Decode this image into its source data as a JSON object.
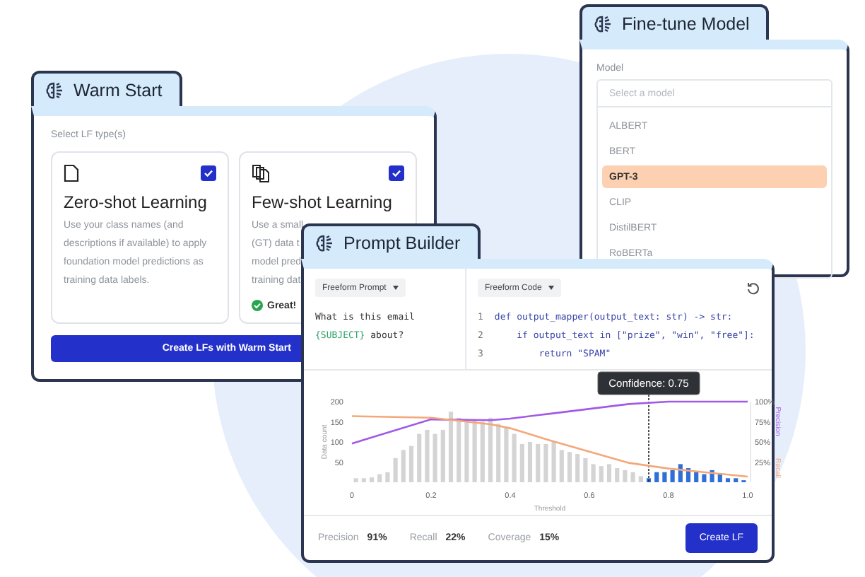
{
  "warm_start": {
    "title": "Warm Start",
    "label": "Select LF type(s)",
    "cards": [
      {
        "kind": "single",
        "title": "Zero-shot Learning",
        "checked": true,
        "description_lines": [
          "Use your class names (and",
          "descriptions if available) to apply",
          "foundation model predictions as",
          "training data labels."
        ]
      },
      {
        "kind": "multi",
        "title": "Few-shot Learning",
        "checked": true,
        "description_lines": [
          "Use a small",
          "(GT) data t",
          "model predi",
          "training dat"
        ],
        "status": "Great!"
      }
    ],
    "button": "Create LFs with Warm Start"
  },
  "fine_tune": {
    "title": "Fine-tune Model",
    "label": "Model",
    "placeholder": "Select a model",
    "options": [
      {
        "label": "ALBERT",
        "selected": false
      },
      {
        "label": "BERT",
        "selected": false
      },
      {
        "label": "GPT-3",
        "selected": true
      },
      {
        "label": "CLIP",
        "selected": false
      },
      {
        "label": "DistilBERT",
        "selected": false
      },
      {
        "label": "RoBERTa",
        "selected": false
      }
    ]
  },
  "prompt_builder": {
    "title": "Prompt Builder",
    "prompt_mode": "Freeform Prompt",
    "prompt_text": "What is this email **{SUBJECT}** about?",
    "code_mode": "Freeform Code",
    "code_lines": [
      {
        "number": "1",
        "text": "def output_mapper(output_text: str) -> str:"
      },
      {
        "number": "2",
        "text": "    if output_text in [\"prize\", \"win\", \"free\"]:"
      },
      {
        "number": "3",
        "text": "        return \"SPAM\""
      }
    ],
    "histogram": {
      "chart_data": {
        "type": "bar",
        "xlabel": "Threshold",
        "xlim": [
          0,
          1
        ],
        "ylim": [
          0,
          200
        ],
        "xticks": [
          {
            "value": 0,
            "label": "0"
          },
          {
            "value": 0.2,
            "label": "0.2"
          },
          {
            "value": 0.4,
            "label": "0.4"
          },
          {
            "value": 0.6,
            "label": "0.6"
          },
          {
            "value": 0.8,
            "label": "0.8"
          },
          {
            "value": 1,
            "label": "1.0"
          }
        ],
        "yticks": [
          50,
          100,
          150,
          200
        ],
        "x": [
          0.01,
          0.03,
          0.05,
          0.07,
          0.09,
          0.11,
          0.13,
          0.15,
          0.17,
          0.19,
          0.21,
          0.23,
          0.25,
          0.27,
          0.29,
          0.31,
          0.33,
          0.35,
          0.37,
          0.39,
          0.41,
          0.43,
          0.45,
          0.47,
          0.49,
          0.51,
          0.53,
          0.55,
          0.57,
          0.59,
          0.61,
          0.63,
          0.65,
          0.67,
          0.69,
          0.71,
          0.73,
          0.75,
          0.77,
          0.79,
          0.81,
          0.83,
          0.85,
          0.87,
          0.89,
          0.91,
          0.93,
          0.95,
          0.97,
          0.99
        ],
        "series": [
          {
            "name": "Data count",
            "color": "#d4d4d4",
            "values": [
              10,
              10,
              12,
              20,
              25,
              60,
              80,
              90,
              120,
              130,
              120,
              130,
              175,
              160,
              150,
              155,
              150,
              160,
              145,
              135,
              120,
              95,
              100,
              95,
              95,
              100,
              80,
              75,
              70,
              60,
              45,
              40,
              45,
              35,
              30,
              25,
              15,
              null,
              null,
              null,
              null,
              null,
              null,
              null,
              null,
              null,
              null,
              null,
              null,
              null
            ]
          },
          {
            "color": "#2f6fd6",
            "values": [
              null,
              null,
              null,
              null,
              null,
              null,
              null,
              null,
              null,
              null,
              null,
              null,
              null,
              null,
              null,
              null,
              null,
              null,
              null,
              null,
              null,
              null,
              null,
              null,
              null,
              null,
              null,
              null,
              null,
              null,
              null,
              null,
              null,
              null,
              null,
              null,
              null,
              10,
              25,
              25,
              30,
              45,
              35,
              25,
              20,
              30,
              20,
              10,
              10,
              5
            ]
          }
        ],
        "annotations": [
          {
            "x": 0.75,
            "text": "Confidence: 0.75"
          }
        ]
      }
    },
    "metrics": {
      "chart_data": {
        "type": "line",
        "xlim": [
          0,
          1
        ],
        "ylim": [
          0,
          100
        ],
        "yticks": [
          {
            "value": 25,
            "label": "25%"
          },
          {
            "value": 50,
            "label": "50%"
          },
          {
            "value": 75,
            "label": "75%"
          },
          {
            "value": 100,
            "label": "100%"
          }
        ],
        "x": [
          0,
          0.2,
          0.35,
          0.4,
          0.5,
          0.7,
          0.8,
          1
        ],
        "series": [
          {
            "name": "Precision",
            "color": "#a259e6",
            "values": [
              48,
              78,
              77,
              79,
              85,
              97,
              100,
              100
            ]
          },
          {
            "name": "Recall",
            "color": "#f4a77a",
            "values": [
              82,
              80,
              72,
              67,
              52,
              24,
              17,
              7
            ]
          }
        ]
      }
    },
    "stats": [
      {
        "label": "Precision",
        "value": "91%"
      },
      {
        "label": "Recall",
        "value": "22%"
      },
      {
        "label": "Coverage",
        "value": "15%"
      }
    ],
    "button": "Create LF"
  }
}
